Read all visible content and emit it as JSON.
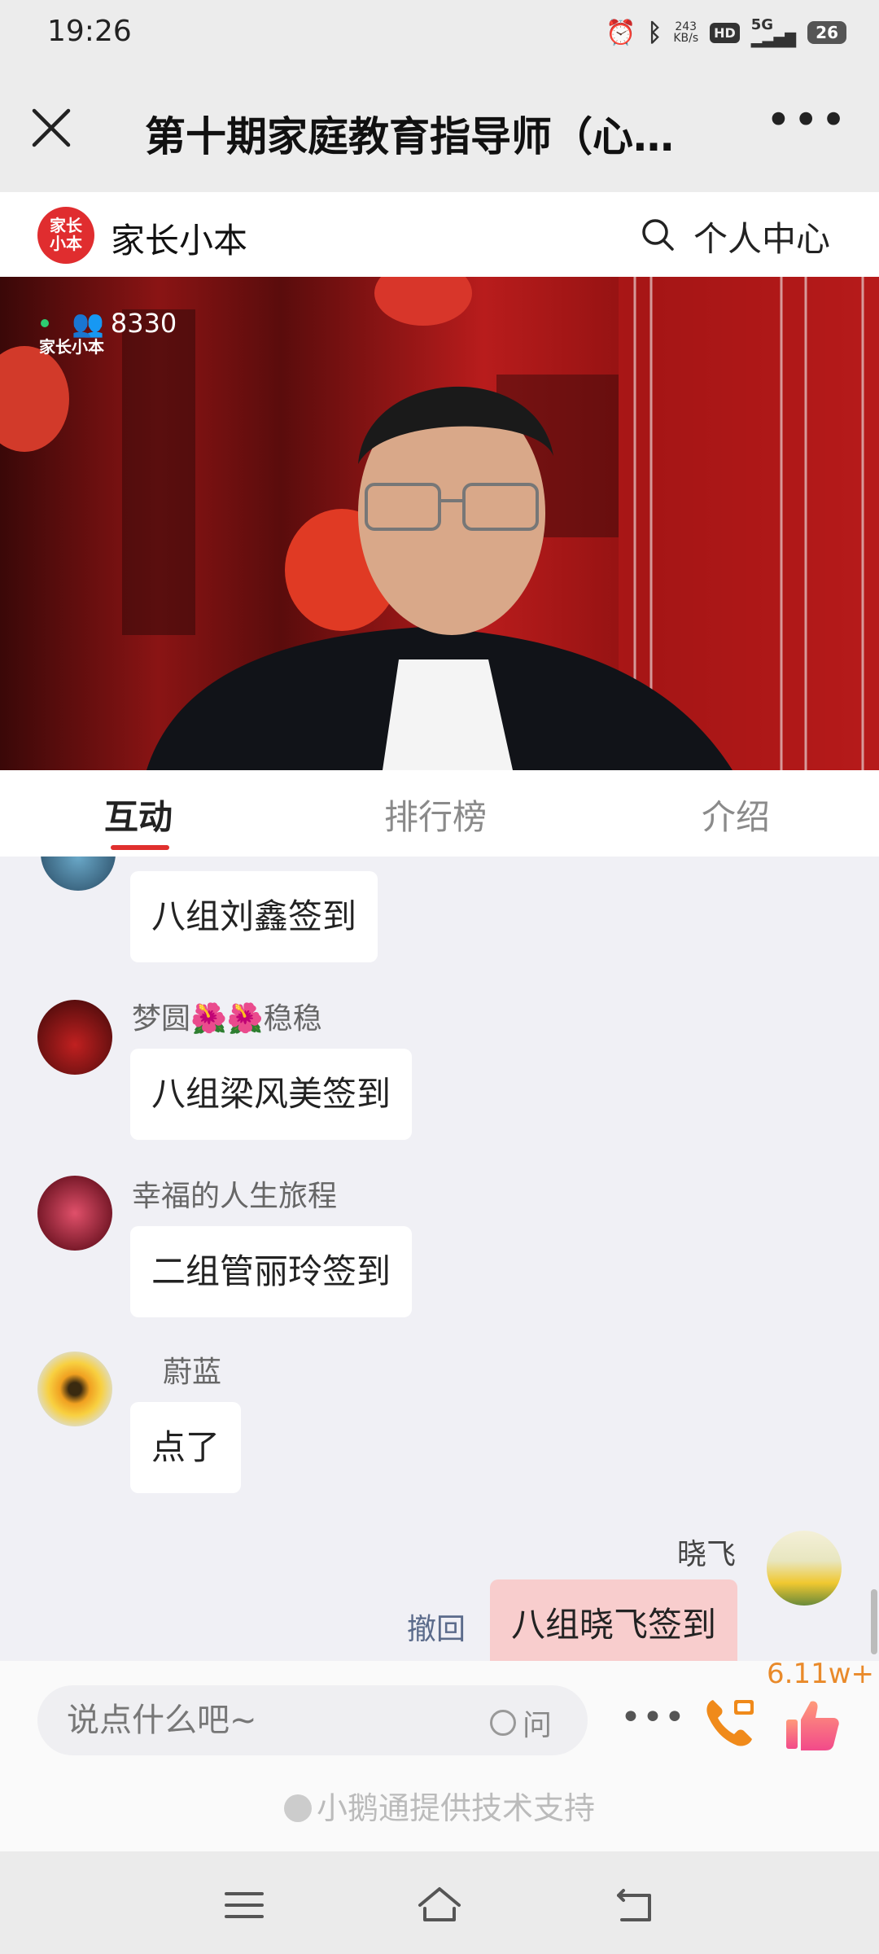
{
  "status_bar": {
    "time": "19:26",
    "net_speed_top": "243",
    "net_speed_bottom": "KB/s",
    "hd_label": "HD",
    "network": "5G",
    "battery": "26"
  },
  "title_bar": {
    "title": "第十期家庭教育指导师（心…"
  },
  "brand": {
    "logo_text": "家长小本",
    "name": "家长小本",
    "personal_center": "个人中心"
  },
  "video": {
    "viewer_count": "8330",
    "watermark": "家长小本"
  },
  "tabs": [
    {
      "label": "互动",
      "active": true
    },
    {
      "label": "排行榜",
      "active": false
    },
    {
      "label": "介绍",
      "active": false
    }
  ],
  "messages": [
    {
      "user": "",
      "text": "八组刘鑫签到"
    },
    {
      "user": "梦圆🌺🌺稳稳",
      "text": "八组梁风美签到"
    },
    {
      "user": "幸福的人生旅程",
      "text": "二组管丽玲签到"
    },
    {
      "user": "蔚蓝",
      "text": "点了"
    },
    {
      "user": "晓飞",
      "text": "八组晓飞签到",
      "mine": true,
      "recall_label": "撤回"
    }
  ],
  "input": {
    "placeholder": "说点什么吧~",
    "ask_label": "问",
    "like_count": "6.11w+",
    "powered_by": "小鹅通提供技术支持"
  },
  "colors": {
    "accent": "#e0302e",
    "own_bubble": "#f8cdcd",
    "like_count": "#e98a2a"
  }
}
